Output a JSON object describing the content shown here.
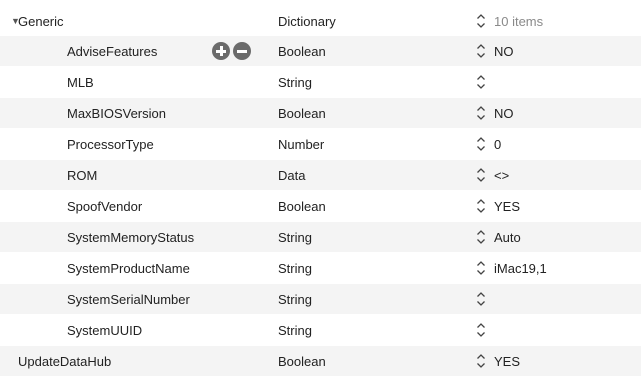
{
  "parent_row": {
    "key": "Generic",
    "type": "Dictionary",
    "value": "10 items"
  },
  "rows": [
    {
      "key": "AdviseFeatures",
      "type": "Boolean",
      "value": "NO"
    },
    {
      "key": "MLB",
      "type": "String",
      "value": ""
    },
    {
      "key": "MaxBIOSVersion",
      "type": "Boolean",
      "value": "NO"
    },
    {
      "key": "ProcessorType",
      "type": "Number",
      "value": "0"
    },
    {
      "key": "ROM",
      "type": "Data",
      "value": "<>"
    },
    {
      "key": "SpoofVendor",
      "type": "Boolean",
      "value": "YES"
    },
    {
      "key": "SystemMemoryStatus",
      "type": "String",
      "value": "Auto"
    },
    {
      "key": "SystemProductName",
      "type": "String",
      "value": "iMac19,1"
    },
    {
      "key": "SystemSerialNumber",
      "type": "String",
      "value": ""
    },
    {
      "key": "SystemUUID",
      "type": "String",
      "value": ""
    }
  ],
  "next_row": {
    "key": "UpdateDataHub",
    "type": "Boolean",
    "value": "YES"
  },
  "icons": {
    "disclosure": "disclosure-triangle-down-icon",
    "stepper": "up-down-stepper-icon",
    "add": "plus-circle-icon",
    "remove": "minus-circle-icon"
  }
}
